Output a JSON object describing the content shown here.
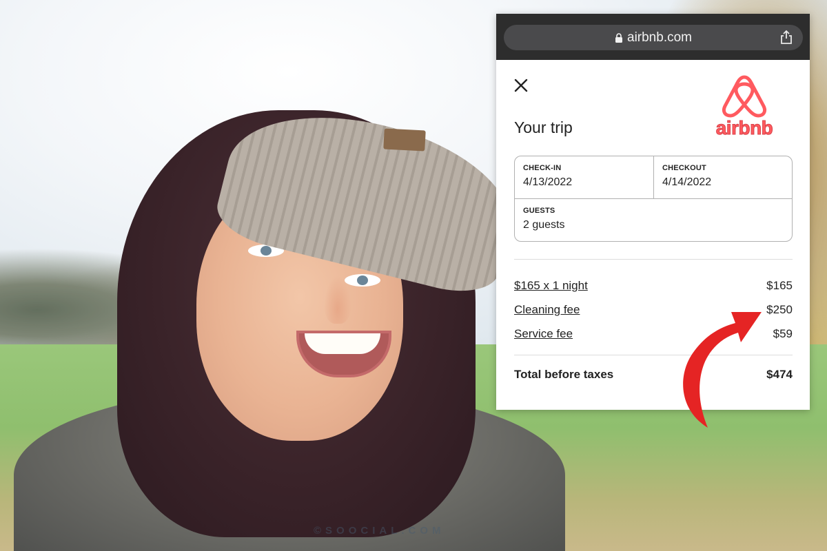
{
  "browser": {
    "url": "airbnb.com"
  },
  "brand": {
    "name": "airbnb",
    "color": "#ff5a5f"
  },
  "trip": {
    "title": "Your trip",
    "checkin": {
      "label": "CHECK-IN",
      "value": "4/13/2022"
    },
    "checkout": {
      "label": "CHECKOUT",
      "value": "4/14/2022"
    },
    "guests": {
      "label": "GUESTS",
      "value": "2 guests"
    }
  },
  "pricing": {
    "rows": [
      {
        "label": "$165 x 1 night",
        "amount": "$165"
      },
      {
        "label": "Cleaning fee",
        "amount": "$250"
      },
      {
        "label": "Service fee",
        "amount": "$59"
      }
    ],
    "total": {
      "label": "Total before taxes",
      "amount": "$474"
    }
  },
  "annotation": {
    "arrow_color": "#e52424"
  },
  "watermark": "©SOOCIAL.COM",
  "icons": [
    "lock-icon",
    "share-icon",
    "close-icon",
    "airbnb-logo-icon",
    "arrow-annotation-icon"
  ]
}
